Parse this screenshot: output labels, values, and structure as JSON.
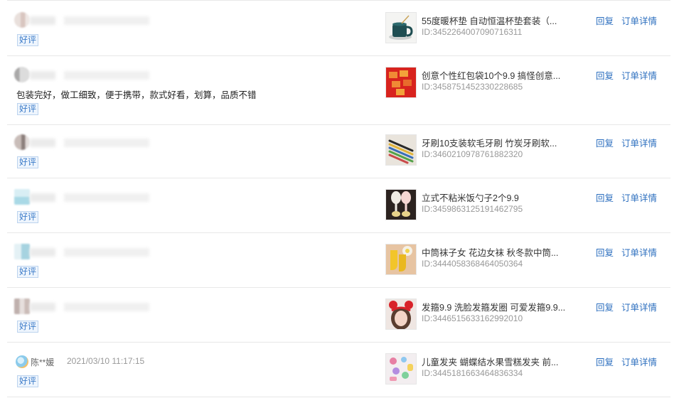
{
  "actions": {
    "reply": "回复",
    "order_detail": "订单详情"
  },
  "reviews": [
    {
      "rating": "好评",
      "comment": "",
      "user_name": "",
      "time": "",
      "product": {
        "title": "55度暖杯垫 自动恒温杯垫套装（...",
        "id": "ID:3452264007090716311",
        "thumb_icon": "mug-thumb"
      }
    },
    {
      "rating": "好评",
      "comment": "包装完好，做工细致，便于携带，款式好看，划算，品质不错",
      "user_name": "",
      "time": "",
      "product": {
        "title": "创意个性红包袋10个9.9 搞怪创意...",
        "id": "ID:3458751452330228685",
        "thumb_icon": "red-envelope-thumb"
      }
    },
    {
      "rating": "好评",
      "comment": "",
      "user_name": "",
      "time": "",
      "product": {
        "title": "牙刷10支装软毛牙刷 竹炭牙刷软...",
        "id": "ID:3460210978761882320",
        "thumb_icon": "toothbrush-thumb"
      }
    },
    {
      "rating": "好评",
      "comment": "",
      "user_name": "",
      "time": "",
      "product": {
        "title": "立式不粘米饭勺子2个9.9",
        "id": "ID:3459863125191462795",
        "thumb_icon": "rice-spoon-thumb"
      }
    },
    {
      "rating": "好评",
      "comment": "",
      "user_name": "",
      "time": "",
      "product": {
        "title": "中筒袜子女 花边女袜 秋冬款中筒...",
        "id": "ID:3444058368464050364",
        "thumb_icon": "socks-thumb"
      }
    },
    {
      "rating": "好评",
      "comment": "",
      "user_name": "",
      "time": "",
      "product": {
        "title": "发箍9.9 洗脸发箍发圈 可爱发箍9.9...",
        "id": "ID:3446515633162992010",
        "thumb_icon": "headband-thumb"
      }
    },
    {
      "rating": "好评",
      "comment": "",
      "user_name": "陈**媛",
      "time": "2021/03/10 11:17:15",
      "product": {
        "title": "儿童发夹 蝴蝶结水果雪糕发夹 前...",
        "id": "ID:3445181663464836334",
        "thumb_icon": "hairclip-thumb"
      }
    }
  ]
}
